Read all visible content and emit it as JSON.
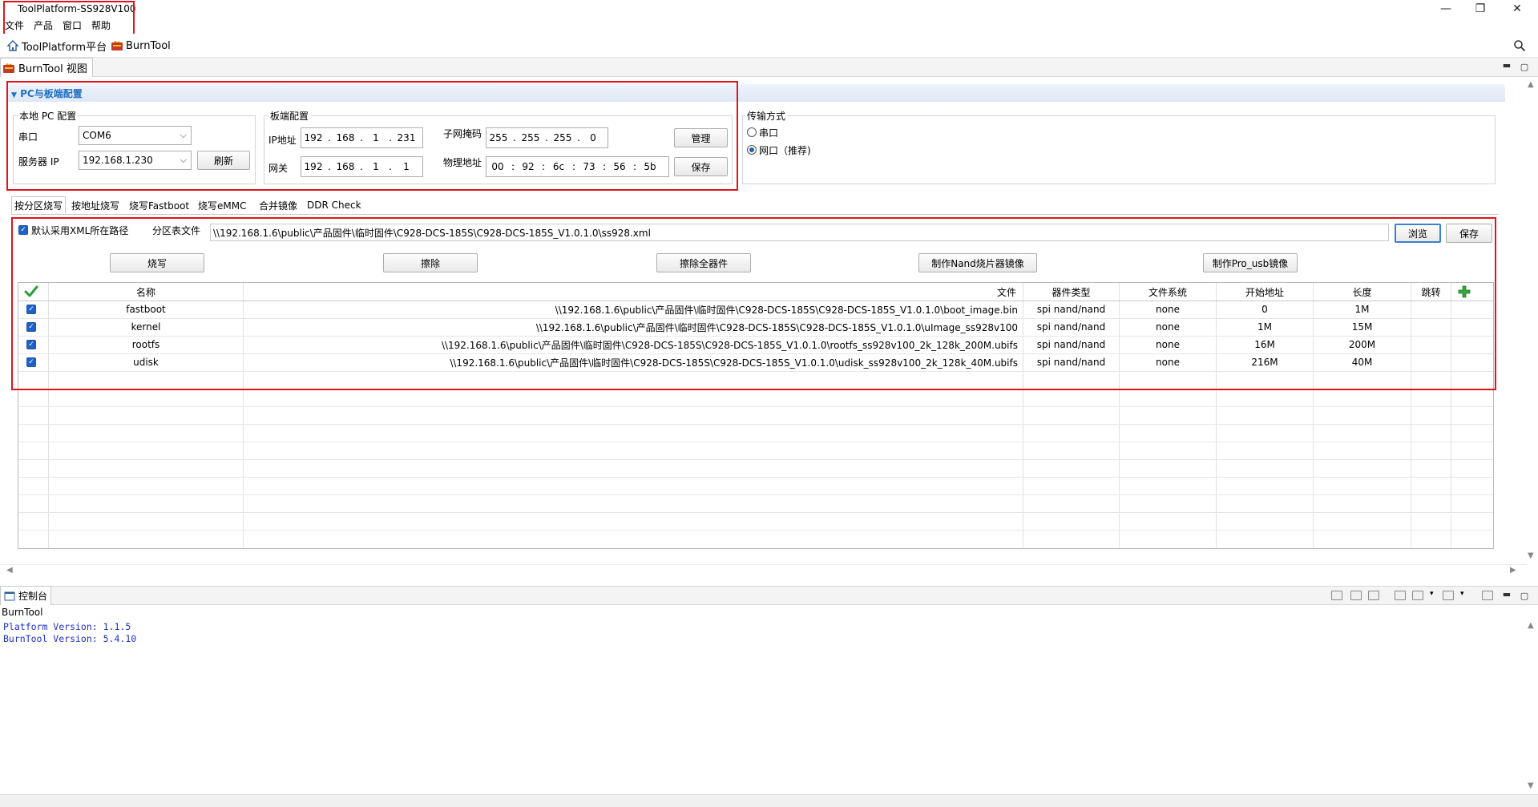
{
  "window": {
    "title": "ToolPlatform-SS928V100"
  },
  "menu": [
    "文件",
    "产品",
    "窗口",
    "帮助"
  ],
  "toolbar": {
    "platform_label": "ToolPlatform平台",
    "burntool_label": "BurnTool"
  },
  "view_tab": {
    "label": "BurnTool 视图"
  },
  "pc_board": {
    "section_title": "PC与板端配置",
    "local_pc": {
      "group_label": "本地 PC 配置",
      "serial_label": "串口",
      "serial_value": "COM6",
      "server_ip_label": "服务器 IP",
      "server_ip_value": "192.168.1.230",
      "refresh_button": "刷新"
    },
    "board": {
      "group_label": "板端配置",
      "ip_label": "IP地址",
      "ip": [
        "192",
        "168",
        "1",
        "231"
      ],
      "gateway_label": "网关",
      "gateway": [
        "192",
        "168",
        "1",
        "1"
      ],
      "mask_label": "子网掩码",
      "mask": [
        "255",
        "255",
        "255",
        "0"
      ],
      "mac_label": "物理地址",
      "mac": [
        "00",
        "92",
        "6c",
        "73",
        "56",
        "5b"
      ],
      "manage_button": "管理",
      "save_button": "保存"
    },
    "transfer": {
      "group_label": "传输方式",
      "option_serial": "串口",
      "option_network": "网口（推荐)",
      "selected": "network"
    }
  },
  "tabs": [
    "按分区烧写",
    "按地址烧写",
    "烧写Fastboot",
    "烧写eMMC",
    "合并镜像",
    "DDR Check"
  ],
  "partition": {
    "default_xml_label": "默认采用XML所在路径",
    "default_xml_checked": true,
    "table_file_label": "分区表文件",
    "table_file_path": "\\\\192.168.1.6\\public\\产品固件\\临时固件\\C928-DCS-185S\\C928-DCS-185S_V1.0.1.0\\ss928.xml",
    "browse_button": "浏览",
    "save_button": "保存",
    "actions": {
      "burn": "烧写",
      "erase": "擦除",
      "erase_all": "擦除全器件",
      "make_nand": "制作Nand烧片器镜像",
      "make_pro_usb": "制作Pro_usb镜像"
    },
    "columns": {
      "name": "名称",
      "file": "文件",
      "device_type": "器件类型",
      "fs": "文件系统",
      "start": "开始地址",
      "length": "长度",
      "skip": "跳转"
    },
    "rows": [
      {
        "checked": true,
        "name": "fastboot",
        "file": "\\\\192.168.1.6\\public\\产品固件\\临时固件\\C928-DCS-185S\\C928-DCS-185S_V1.0.1.0\\boot_image.bin",
        "device_type": "spi nand/nand",
        "fs": "none",
        "start": "0",
        "length": "1M"
      },
      {
        "checked": true,
        "name": "kernel",
        "file": "\\\\192.168.1.6\\public\\产品固件\\临时固件\\C928-DCS-185S\\C928-DCS-185S_V1.0.1.0\\uImage_ss928v100",
        "device_type": "spi nand/nand",
        "fs": "none",
        "start": "1M",
        "length": "15M"
      },
      {
        "checked": true,
        "name": "rootfs",
        "file": "\\\\192.168.1.6\\public\\产品固件\\临时固件\\C928-DCS-185S\\C928-DCS-185S_V1.0.1.0\\rootfs_ss928v100_2k_128k_200M.ubifs",
        "device_type": "spi nand/nand",
        "fs": "none",
        "start": "16M",
        "length": "200M"
      },
      {
        "checked": true,
        "name": "udisk",
        "file": "\\\\192.168.1.6\\public\\产品固件\\临时固件\\C928-DCS-185S\\C928-DCS-185S_V1.0.1.0\\udisk_ss928v100_2k_128k_40M.ubifs",
        "device_type": "spi nand/nand",
        "fs": "none",
        "start": "216M",
        "length": "40M"
      }
    ]
  },
  "console": {
    "tab_label": "控制台",
    "source": "BurnTool",
    "lines": [
      "Platform Version: 1.1.5",
      "BurnTool Version: 5.4.10"
    ]
  },
  "colors": {
    "highlight_box": "#e0141c",
    "accent": "#1f6fc5",
    "console_text": "#1d2fd0"
  }
}
